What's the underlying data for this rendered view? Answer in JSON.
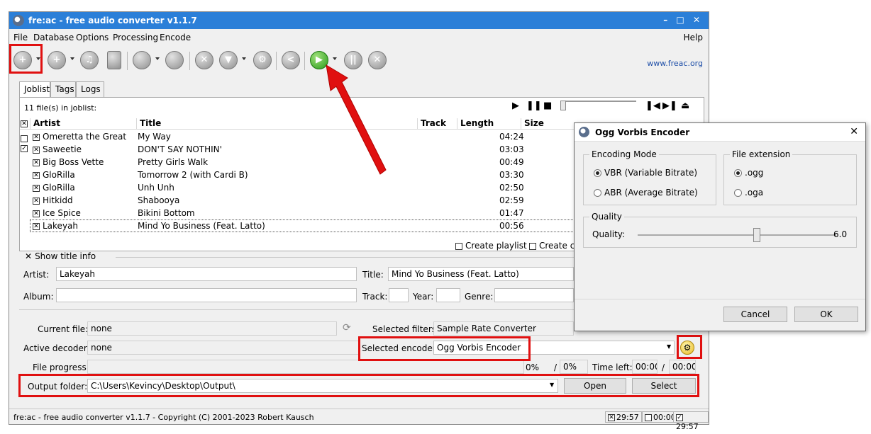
{
  "window": {
    "title": "fre:ac - free audio converter v1.1.7",
    "controls": "– □ ✕"
  },
  "menu": [
    "File",
    "Database",
    "Options",
    "Processing",
    "Encode"
  ],
  "menu_right": "Help",
  "website": "www.freac.org",
  "tabs": [
    "Joblist",
    "Tags",
    "Logs"
  ],
  "joblist": {
    "count_label": "11 file(s) in joblist:",
    "columns": [
      "Artist",
      "Title",
      "Track",
      "Length",
      "Size"
    ],
    "rows": [
      {
        "artist": "Omeretta the Great",
        "title": "My Way",
        "track": "",
        "length": "04:24"
      },
      {
        "artist": "Saweetie",
        "title": "DON'T SAY NOTHIN'",
        "track": "",
        "length": "03:03"
      },
      {
        "artist": "Big Boss Vette",
        "title": "Pretty Girls Walk",
        "track": "",
        "length": "00:49"
      },
      {
        "artist": "GloRilla",
        "title": "Tomorrow 2 (with Cardi B)",
        "track": "",
        "length": "03:30"
      },
      {
        "artist": "GloRilla",
        "title": "Unh Unh",
        "track": "",
        "length": "02:50"
      },
      {
        "artist": "Hitkidd",
        "title": "Shabooya",
        "track": "",
        "length": "02:59"
      },
      {
        "artist": "Ice Spice",
        "title": "Bikini Bottom",
        "track": "",
        "length": "01:47"
      },
      {
        "artist": "Lakeyah",
        "title": "Mind Yo Business (Feat. Latto)",
        "track": "",
        "length": "00:56"
      }
    ],
    "create_playlist": "Create playlist",
    "create_cue": "Create cue s"
  },
  "title_info": {
    "show_label": "Show title info",
    "artist_label": "Artist:",
    "artist_value": "Lakeyah",
    "title_label": "Title:",
    "title_value": "Mind Yo Business (Feat. Latto)",
    "album_label": "Album:",
    "album_value": "",
    "track_label": "Track:",
    "year_label": "Year:",
    "genre_label": "Genre:"
  },
  "status": {
    "current_file_label": "Current file:",
    "current_file_value": "none",
    "active_decoder_label": "Active decoder:",
    "active_decoder_value": "none",
    "file_progress_label": "File progress:",
    "selected_filters_label": "Selected filters:",
    "selected_filters_value": "Sample Rate Converter",
    "selected_encoder_label": "Selected encoder:",
    "selected_encoder_value": "Ogg Vorbis Encoder",
    "progress_pct1": "0%",
    "progress_pct2": "0%",
    "time_left_label": "Time left:",
    "time_left1": "00:00",
    "time_left2": "00:00",
    "output_folder_label": "Output folder:",
    "output_folder_value": "C:\\Users\\Kevincy\\Desktop\\Output\\",
    "open_button": "Open",
    "select_button": "Select"
  },
  "statusbar": {
    "text": "fre:ac - free audio converter v1.1.7 - Copyright (C) 2001-2023 Robert Kausch",
    "box1": "29:57",
    "box2": "00:00",
    "box3": "29:57"
  },
  "dialog": {
    "title": "Ogg Vorbis Encoder",
    "encoding_mode_label": "Encoding Mode",
    "vbr_label": "VBR (Variable Bitrate)",
    "abr_label": "ABR (Average Bitrate)",
    "file_extension_label": "File extension",
    "ext_ogg": ".ogg",
    "ext_oga": ".oga",
    "quality_group_label": "Quality",
    "quality_label": "Quality:",
    "quality_value": "6.0",
    "quality_fraction": 0.6,
    "cancel_button": "Cancel",
    "ok_button": "OK"
  },
  "colors": {
    "titlebar": "#2b7fd8",
    "highlight": "#e01010",
    "play": "#2a9c1b"
  }
}
